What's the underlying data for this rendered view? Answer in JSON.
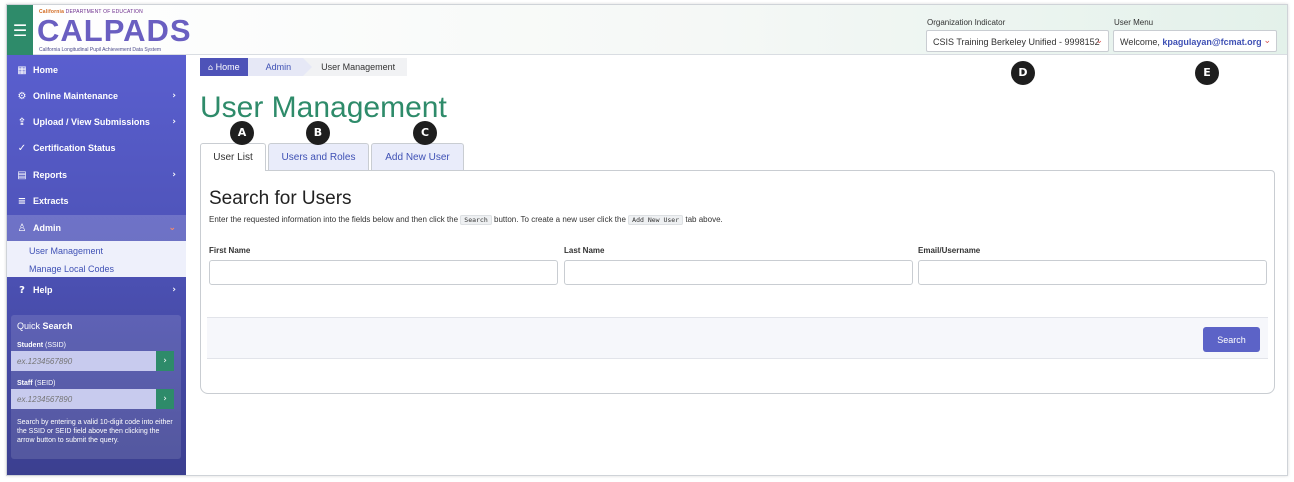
{
  "header": {
    "logo": {
      "dept_prefix": "California",
      "dept": "DEPARTMENT OF EDUCATION",
      "word": "CALPADS",
      "subtitle": "California Longitudinal Pupil Achievement Data System"
    },
    "org_indicator_label": "Organization Indicator",
    "org_indicator_value": "CSIS Training Berkeley Unified - 9998152",
    "user_menu_label": "User Menu",
    "user_welcome": "Welcome,",
    "user_email": "kpagulayan@fcmat.org"
  },
  "sidebar": {
    "items": [
      {
        "label": "Home",
        "icon": "grid-icon",
        "glyph": "▦",
        "arrow": ""
      },
      {
        "label": "Online Maintenance",
        "icon": "gear-icon",
        "glyph": "⚙",
        "arrow": "›"
      },
      {
        "label": "Upload / View Submissions",
        "icon": "upload-icon",
        "glyph": "⇪",
        "arrow": "›"
      },
      {
        "label": "Certification Status",
        "icon": "check-circle-icon",
        "glyph": "✓",
        "arrow": ""
      },
      {
        "label": "Reports",
        "icon": "document-icon",
        "glyph": "▤",
        "arrow": "›"
      },
      {
        "label": "Extracts",
        "icon": "database-icon",
        "glyph": "≡",
        "arrow": ""
      },
      {
        "label": "Admin",
        "icon": "user-icon",
        "glyph": "♙",
        "arrow": "⌄"
      },
      {
        "label": "Help",
        "icon": "help-icon",
        "glyph": "?",
        "arrow": "›"
      }
    ],
    "admin_submenu": [
      "User Management",
      "Manage Local Codes"
    ],
    "quick_search": {
      "title_prefix": "Quick",
      "title_bold": "Search",
      "student_label": "Student",
      "student_hint": "(SSID)",
      "student_placeholder": "ex.1234567890",
      "staff_label": "Staff",
      "staff_hint": "(SEID)",
      "staff_placeholder": "ex.1234567890",
      "help_text": "Search by entering a valid 10-digit code into either the SSID or SEID field above then clicking the arrow button to submit the query."
    }
  },
  "breadcrumb": {
    "home": "Home",
    "admin": "Admin",
    "current": "User Management"
  },
  "page_title": "User Management",
  "tabs": [
    "User List",
    "Users and Roles",
    "Add New User"
  ],
  "panel": {
    "title": "Search for Users",
    "desc_1": "Enter the requested information into the fields below and then click the",
    "desc_code_1": "Search",
    "desc_2": "button. To create a new user click the",
    "desc_code_2": "Add New User",
    "desc_3": "tab above.",
    "fields": [
      "First Name",
      "Last Name",
      "Email/Username"
    ],
    "search_button": "Search"
  },
  "callouts": [
    "A",
    "B",
    "C",
    "D",
    "E"
  ],
  "colors": {
    "brand_green": "#2e8b6a",
    "brand_purple": "#5a5fcf",
    "link_blue": "#3f51b5"
  }
}
